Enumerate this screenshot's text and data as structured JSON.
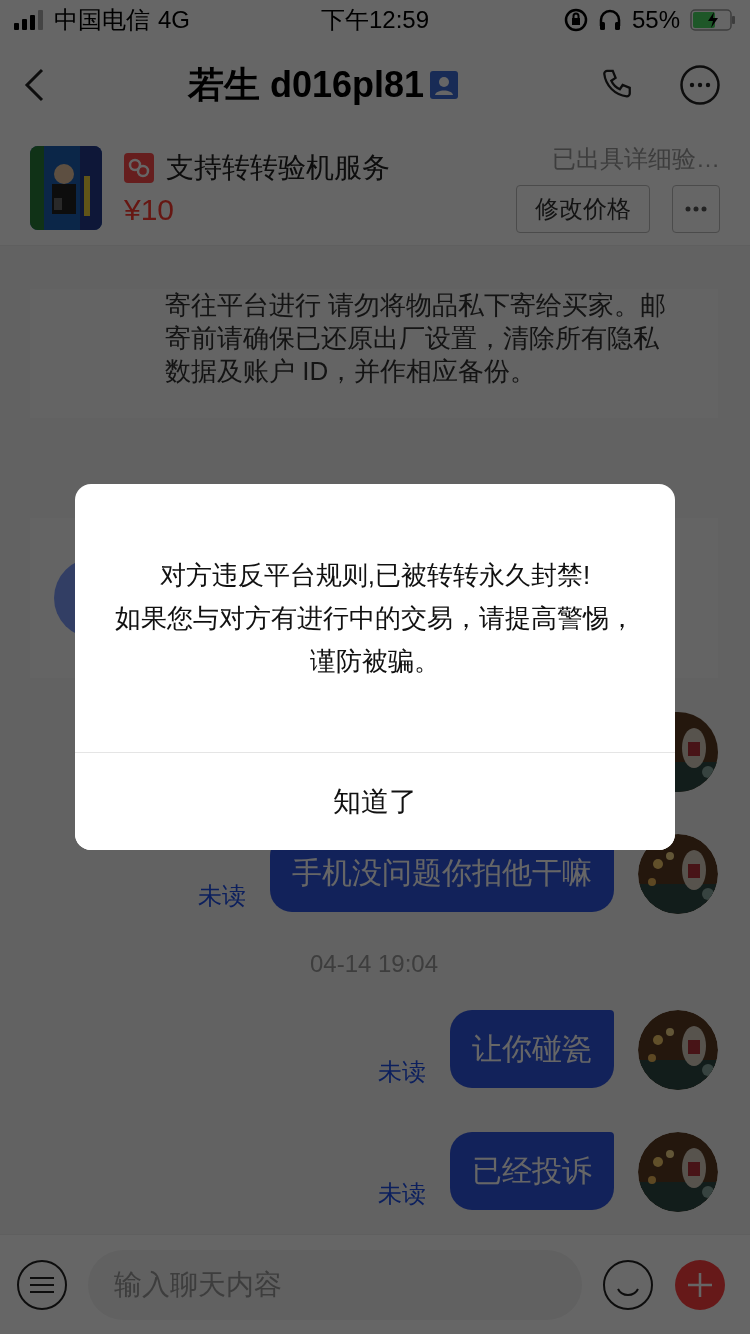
{
  "status_bar": {
    "carrier": "中国电信",
    "network": "4G",
    "time": "下午12:59",
    "battery": "55%"
  },
  "header": {
    "title": "若生 d016pl81"
  },
  "product": {
    "service": "支持转转验机服务",
    "price": "¥10",
    "report": "已出具详细验…",
    "button": "修改价格"
  },
  "messages": [
    {
      "kind": "notice",
      "text": "寄往平台进行     请勿将物品私下寄给买家。邮寄前请确保已还原出厂设置，清除所有隐私数据及账户 ID，并作相应备份。"
    },
    {
      "kind": "card"
    },
    {
      "kind": "message"
    },
    {
      "kind": "message",
      "text": "手机没问题你拍他干嘛",
      "status": "未读"
    },
    {
      "kind": "time",
      "text": "04-14 19:04"
    },
    {
      "kind": "message",
      "text": "让你碰瓷",
      "status": "未读"
    },
    {
      "kind": "message",
      "text": "已经投诉",
      "status": "未读"
    }
  ],
  "input": {
    "placeholder": "输入聊天内容"
  },
  "dialog": {
    "lines": [
      "对方违反平台规则,已被转转永久封禁!",
      "如果您与对方有进行中的交易，请提高警惕，谨防被骗。"
    ],
    "button": "知道了"
  }
}
